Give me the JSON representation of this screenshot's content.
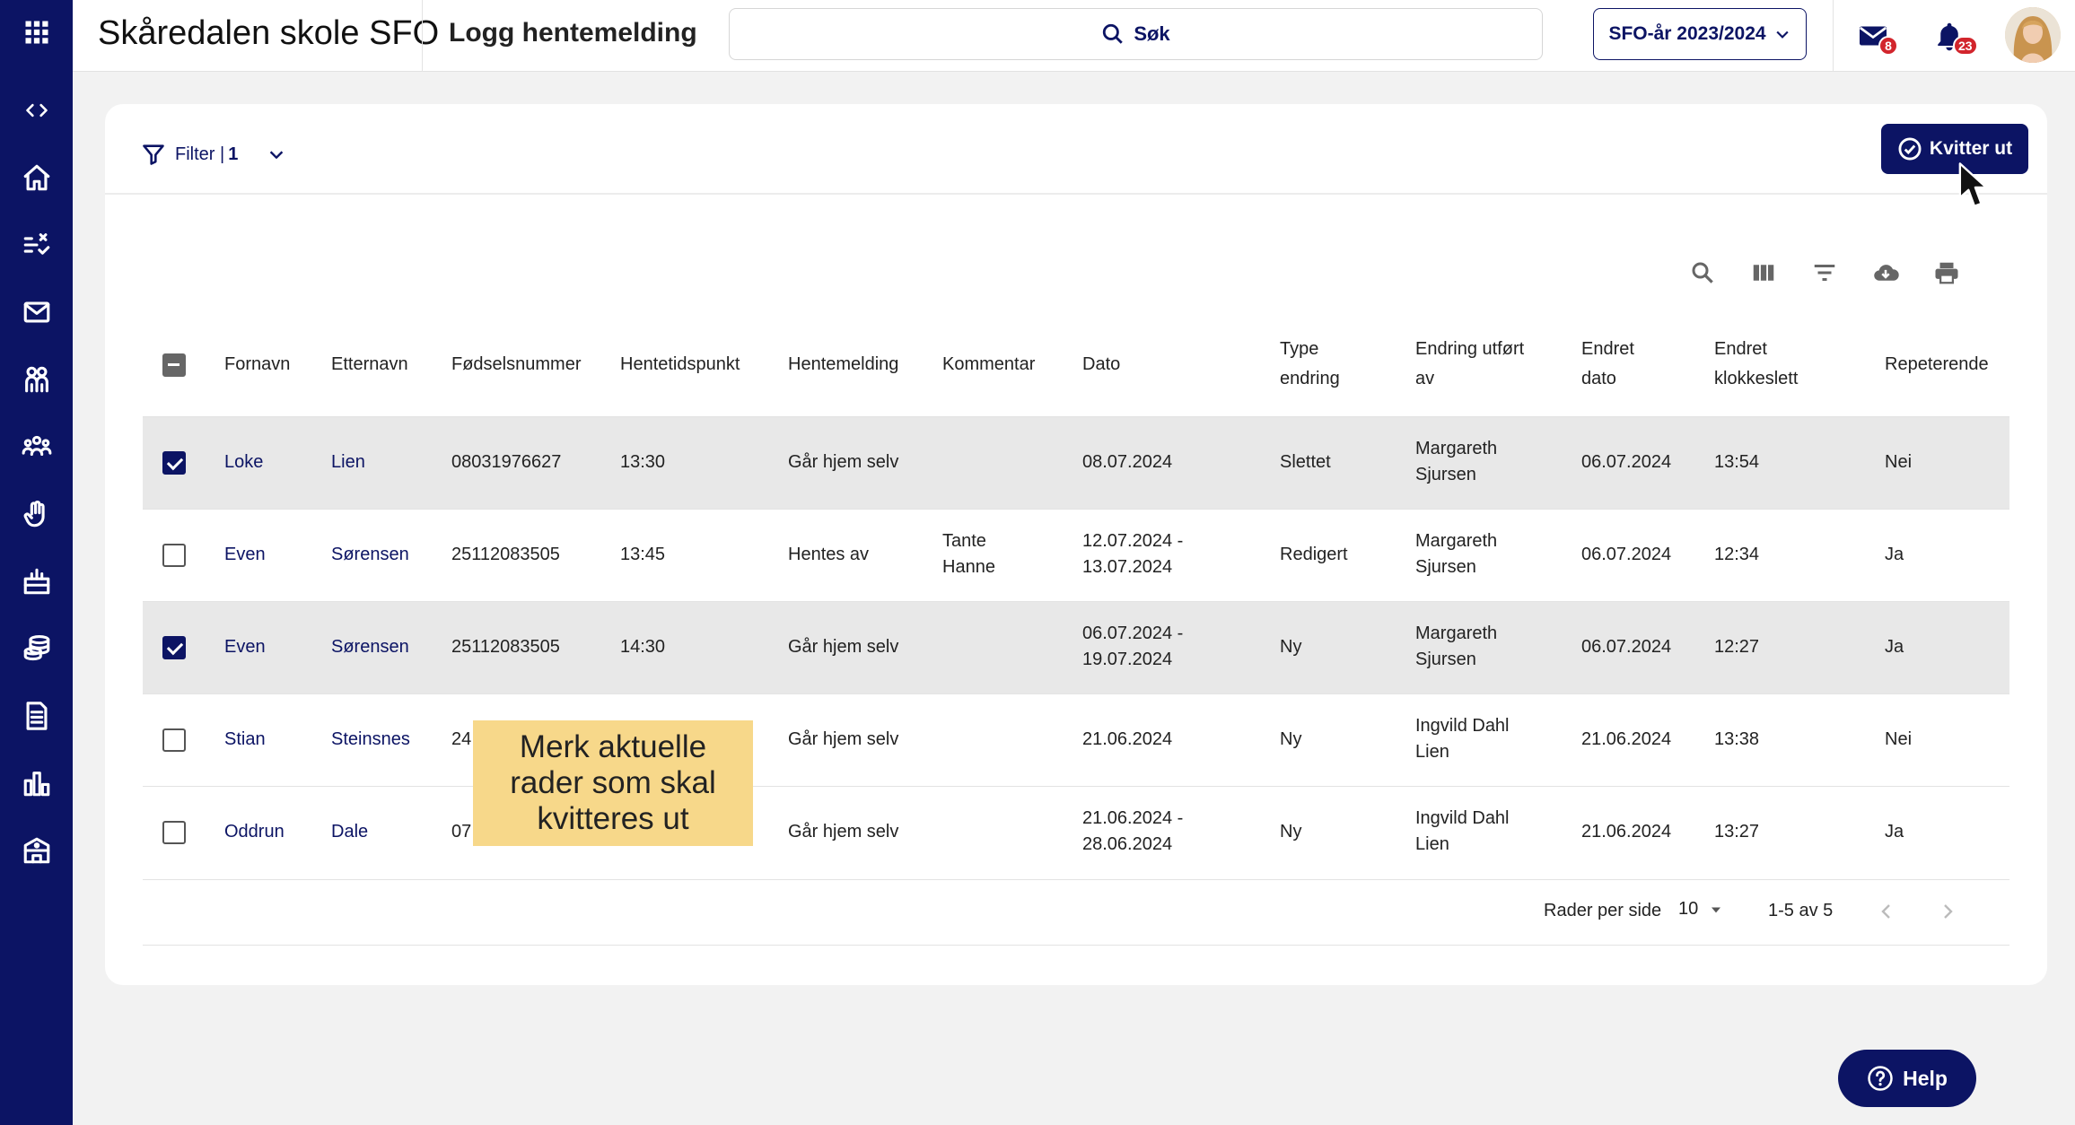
{
  "header": {
    "school_name": "Skåredalen skole SFO",
    "page_title": "Logg hentemelding",
    "search_label": "Søk",
    "year_label": "SFO-år 2023/2024",
    "messages_badge": "8",
    "notifications_badge": "23"
  },
  "toolbar": {
    "filter_label": "Filter |",
    "filter_count": "1",
    "kvitter_label": "Kvitter ut"
  },
  "table": {
    "headers": {
      "fornavn": "Fornavn",
      "etternavn": "Etternavn",
      "fodselsnummer": "Fødselsnummer",
      "hentetidspunkt": "Hentetidspunkt",
      "hentemelding": "Hentemelding",
      "kommentar": "Kommentar",
      "dato": "Dato",
      "type_endring_1": "Type",
      "type_endring_2": "endring",
      "endring_av_1": "Endring utført",
      "endring_av_2": "av",
      "endret_dato_1": "Endret",
      "endret_dato_2": "dato",
      "endret_klokke_1": "Endret",
      "endret_klokke_2": "klokkeslett",
      "repeterende": "Repeterende"
    },
    "rows": [
      {
        "selected": true,
        "fornavn": "Loke",
        "etternavn": "Lien",
        "fnr": "08031976627",
        "tid": "13:30",
        "melding": "Går hjem selv",
        "kommentar_1": "",
        "kommentar_2": "",
        "dato_1": "08.07.2024",
        "dato_2": "",
        "type": "Slettet",
        "av_1": "Margareth",
        "av_2": "Sjursen",
        "endret_dato": "06.07.2024",
        "endret_klokke": "13:54",
        "repeterende": "Nei"
      },
      {
        "selected": false,
        "fornavn": "Even",
        "etternavn": "Sørensen",
        "fnr": "25112083505",
        "tid": "13:45",
        "melding": "Hentes av",
        "kommentar_1": "Tante",
        "kommentar_2": "Hanne",
        "dato_1": "12.07.2024 -",
        "dato_2": "13.07.2024",
        "type": "Redigert",
        "av_1": "Margareth",
        "av_2": "Sjursen",
        "endret_dato": "06.07.2024",
        "endret_klokke": "12:34",
        "repeterende": "Ja"
      },
      {
        "selected": true,
        "fornavn": "Even",
        "etternavn": "Sørensen",
        "fnr": "25112083505",
        "tid": "14:30",
        "melding": "Går hjem selv",
        "kommentar_1": "",
        "kommentar_2": "",
        "dato_1": "06.07.2024 -",
        "dato_2": "19.07.2024",
        "type": "Ny",
        "av_1": "Margareth",
        "av_2": "Sjursen",
        "endret_dato": "06.07.2024",
        "endret_klokke": "12:27",
        "repeterende": "Ja"
      },
      {
        "selected": false,
        "fornavn": "Stian",
        "etternavn": "Steinsnes",
        "fnr": "24",
        "tid": "",
        "melding": "Går hjem selv",
        "kommentar_1": "",
        "kommentar_2": "",
        "dato_1": "21.06.2024",
        "dato_2": "",
        "type": "Ny",
        "av_1": "Ingvild Dahl",
        "av_2": "Lien",
        "endret_dato": "21.06.2024",
        "endret_klokke": "13:38",
        "repeterende": "Nei"
      },
      {
        "selected": false,
        "fornavn": "Oddrun",
        "etternavn": "Dale",
        "fnr": "07",
        "tid": "",
        "melding": "Går hjem selv",
        "kommentar_1": "",
        "kommentar_2": "",
        "dato_1": "21.06.2024 -",
        "dato_2": "28.06.2024",
        "type": "Ny",
        "av_1": "Ingvild Dahl",
        "av_2": "Lien",
        "endret_dato": "21.06.2024",
        "endret_klokke": "13:27",
        "repeterende": "Ja"
      }
    ]
  },
  "pagination": {
    "rows_per_page_label": "Rader per side",
    "rows_per_page_value": "10",
    "range": "1-5 av 5"
  },
  "callout": {
    "text": "Merk aktuelle rader som skal kvitteres ut"
  },
  "help": {
    "label": "Help"
  },
  "colors": {
    "brand": "#0c1464",
    "badge": "#d2252c",
    "callout": "#f7d88a",
    "selected_row": "#e8e8e8"
  }
}
